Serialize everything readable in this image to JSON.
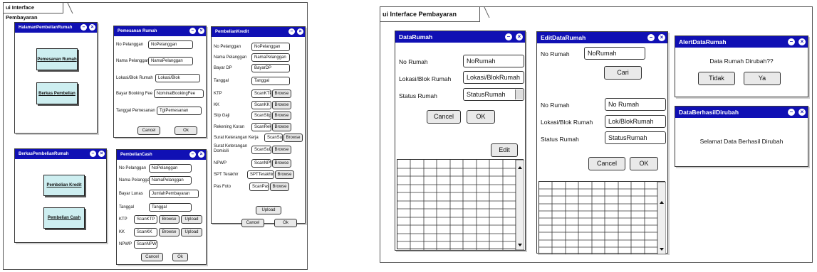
{
  "frames": {
    "left": {
      "title": "ui Interface Pembayaran"
    },
    "right": {
      "title": "ui Interface Pembayaran"
    }
  },
  "icons": {
    "minimize": "minimize-icon",
    "close": "close-icon"
  },
  "colors": {
    "titlebar": "#1010b4",
    "tile": "#cdeef0"
  },
  "halaman": {
    "title": "HalamanPembelianRumah",
    "tile1": "Pemesanan Rumah",
    "tile2": "Berkas Pembelian"
  },
  "berkas": {
    "title": "BerkasPembelianRumah",
    "tile1": "Pembelian Kredit",
    "tile2": "Pembelian Cash"
  },
  "pemesanan": {
    "title": "Pemesanan Rumah",
    "rows": [
      {
        "label": "No Pelanggan",
        "value": "NoPelanggan"
      },
      {
        "label": "Nama Pelanggan",
        "value": "NamaPelanggan"
      },
      {
        "label": "Lokasi/Blok Rumah",
        "value": "Lokasi/Blok"
      },
      {
        "label": "Bayar Booking Fee",
        "value": "NominalBookingFee"
      },
      {
        "label": "Tanggal Pemesanan",
        "value": "TglPemesanan"
      }
    ],
    "cancel": "Cancel",
    "ok": "Ok"
  },
  "cash": {
    "title": "PembelianCash",
    "rows": [
      {
        "label": "No Pelanggan",
        "value": "NoPelanggan"
      },
      {
        "label": "Nama Pelanggan",
        "value": "NamaPelanggan"
      },
      {
        "label": "Bayar Lunas",
        "value": "JumlahPembayaran"
      },
      {
        "label": "Tanggal",
        "value": "Tanggal"
      },
      {
        "label": "KTP",
        "value": "ScanKTP"
      },
      {
        "label": "KK",
        "value": "ScanKK"
      },
      {
        "label": "NPWP",
        "value": "ScanNPWP"
      }
    ],
    "browse": "Browse",
    "upload": "Upload",
    "cancel": "Cancel",
    "ok": "Ok"
  },
  "kredit": {
    "title": "PembelianKredit",
    "rows": [
      {
        "label": "No Pelanggan",
        "value": "NoPelanggan"
      },
      {
        "label": "Nama Pelanggan",
        "value": "NamaPelanggan"
      },
      {
        "label": "Bayar DP",
        "value": "BayarDP"
      },
      {
        "label": "Tanggal",
        "value": "Tanggal"
      },
      {
        "label": "KTP",
        "value": "ScanKTP"
      },
      {
        "label": "KK",
        "value": "ScanKK"
      },
      {
        "label": "Slip Gaji",
        "value": "ScanSlip"
      },
      {
        "label": "Rekening Koran",
        "value": "ScanRekKo"
      },
      {
        "label": "Surat Keterangan Kerja",
        "value": "ScanSuKe"
      },
      {
        "label": "Surat Keterangan Domisili",
        "value": "ScanSuDom"
      },
      {
        "label": "NPWP",
        "value": "ScanNPWP"
      },
      {
        "label": "SPT Terakhir",
        "value": "SPTTerakhir"
      },
      {
        "label": "Pas Foto",
        "value": "ScanPasFoto"
      }
    ],
    "browse": "Browse",
    "upload": "Upload",
    "cancel": "Cancel",
    "ok": "Ok"
  },
  "datarumah": {
    "title": "DataRumah",
    "no_label": "No Rumah",
    "no_value": "NoRumah",
    "lokasi_label": "Lokasi/Blok Rumah",
    "lokasi_value": "Lokasi/BlokRumah",
    "status_label": "Status Rumah",
    "status_value": "StatusRumah",
    "cancel": "Cancel",
    "ok": "OK",
    "edit": "Edit"
  },
  "edit": {
    "title": "EditDataRumah",
    "search_label": "No Rumah",
    "search_value": "NoRumah",
    "cari": "Cari",
    "no_label": "No Rumah",
    "no_value": "No Rumah",
    "lokasi_label": "Lokasi/Blok Rumah",
    "lokasi_value": "Lok/BlokRumah",
    "status_label": "Status Rumah",
    "status_value": "StatusRumah",
    "cancel": "Cancel",
    "ok": "OK"
  },
  "alert": {
    "title": "AlertDataRumah",
    "message": "Data Rumah Dirubah??",
    "no": "Tidak",
    "yes": "Ya"
  },
  "berhasil": {
    "title": "DataBerhasilDirubah",
    "message": "Selamat Data Berhasil Dirubah"
  }
}
